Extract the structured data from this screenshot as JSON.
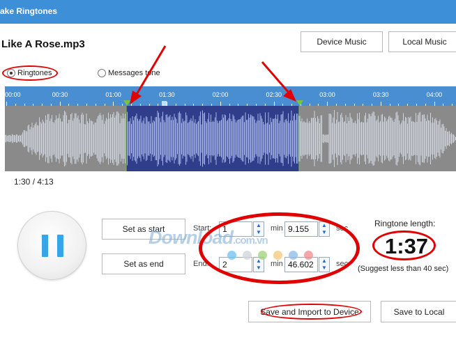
{
  "window": {
    "title": "ake Ringtones"
  },
  "file": {
    "name": "Like A Rose.mp3"
  },
  "source_buttons": {
    "device": "Device Music",
    "local": "Local Music"
  },
  "modes": [
    {
      "label": "Ringtones",
      "selected": true
    },
    {
      "label": "Messages tone",
      "selected": false
    }
  ],
  "timeline": {
    "ticks": [
      "00:00",
      "00:30",
      "01:00",
      "01:30",
      "02:00",
      "02:30",
      "03:00",
      "03:30",
      "04:00"
    ]
  },
  "position_readout": "1:30 / 4:13",
  "controls": {
    "set_start_label": "Set as start",
    "set_end_label": "Set as end",
    "start_label": "Start:",
    "end_label": "End:",
    "start_min": "1",
    "start_sec": "9.155",
    "end_min": "2",
    "end_sec": "46.602",
    "min_unit": "min",
    "sec_unit": "sec"
  },
  "ringtone": {
    "length_label": "Ringtone length:",
    "length_value": "1:37",
    "suggestion": "(Suggest less than 40 sec)"
  },
  "footer": {
    "save_import_label": "Save and Import to Device",
    "save_local_label": "Save to Local"
  },
  "watermark": {
    "text": "Download",
    "suffix": ".com.vn"
  },
  "colors": {
    "accent": "#3d8fd8",
    "selection": "#2f3d8a",
    "marker": "#7cc142",
    "annotation": "#e00000",
    "pause": "#35a6e8"
  },
  "icons": {
    "play_button": "pause-icon",
    "start_marker": "start-marker-icon",
    "end_marker": "end-marker-icon"
  }
}
